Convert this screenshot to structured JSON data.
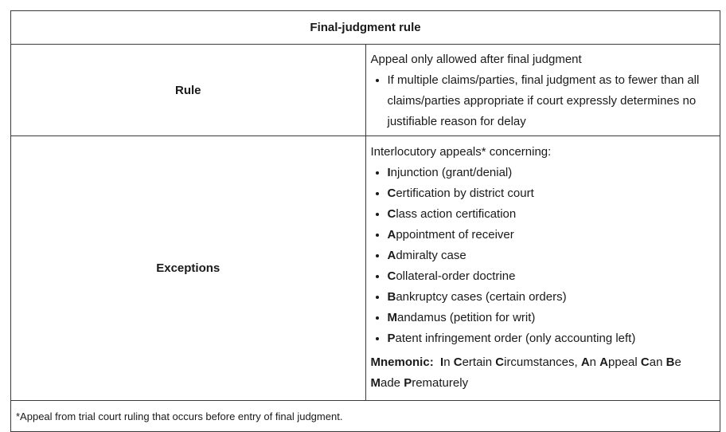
{
  "table": {
    "title": "Final-judgment rule",
    "rule": {
      "label": "Rule",
      "intro": "Appeal only allowed after final judgment",
      "bullets": [
        "If multiple claims/parties, final judgment as to fewer than all claims/parties appropriate if court expressly determines no justifiable reason for delay"
      ]
    },
    "exceptions": {
      "label": "Exceptions",
      "intro": "Interlocutory appeals* concerning:",
      "items": [
        {
          "letter": "I",
          "rest": "njunction (grant/denial)"
        },
        {
          "letter": "C",
          "rest": "ertification by district court"
        },
        {
          "letter": "C",
          "rest": "lass action certification"
        },
        {
          "letter": "A",
          "rest": "ppointment of receiver"
        },
        {
          "letter": "A",
          "rest": "dmiralty case"
        },
        {
          "letter": "C",
          "rest": "ollateral-order doctrine"
        },
        {
          "letter": "B",
          "rest": "ankruptcy cases (certain orders)"
        },
        {
          "letter": "M",
          "rest": "andamus (petition for writ)"
        },
        {
          "letter": "P",
          "rest": "atent infringement order (only accounting left)"
        }
      ],
      "mnemonic_label": "Mnemonic",
      "mnemonic_words": [
        {
          "letter": "I",
          "rest": "n"
        },
        {
          "letter": "C",
          "rest": "ertain"
        },
        {
          "letter": "C",
          "rest": "ircumstances,"
        },
        {
          "letter": "A",
          "rest": "n"
        },
        {
          "letter": "A",
          "rest": "ppeal"
        },
        {
          "letter": "C",
          "rest": "an"
        },
        {
          "letter": "B",
          "rest": "e"
        },
        {
          "letter": "M",
          "rest": "ade"
        },
        {
          "letter": "P",
          "rest": "rematurely"
        }
      ]
    },
    "footnote": "*Appeal from trial court ruling that occurs before entry of final judgment."
  }
}
